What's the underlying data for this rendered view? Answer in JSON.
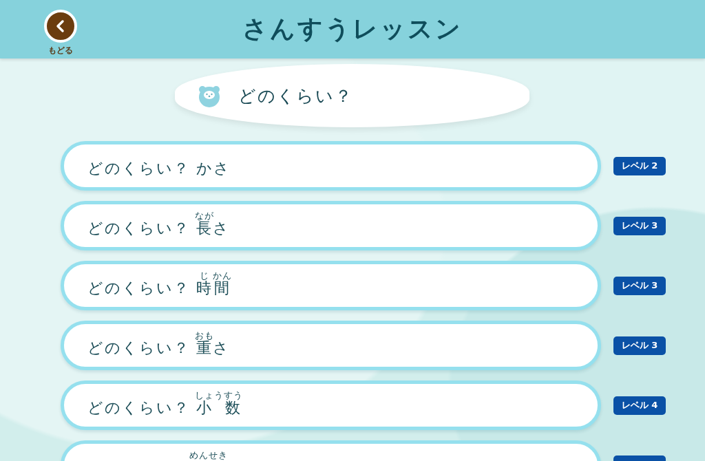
{
  "header": {
    "back_label": "もどる",
    "title": "さんすうレッスン"
  },
  "section": {
    "title": "どのくらい？"
  },
  "lessons": [
    {
      "kind": "full",
      "prefix": "どのくらい？",
      "parts": [
        {
          "base": "かさ"
        }
      ],
      "level": "レベル 2"
    },
    {
      "kind": "full",
      "prefix": "どのくらい？",
      "parts": [
        {
          "base": "長",
          "ruby": "なが"
        },
        {
          "base": "さ"
        }
      ],
      "level": "レベル 3"
    },
    {
      "kind": "full",
      "prefix": "どのくらい？",
      "parts": [
        {
          "base": "時",
          "ruby": "じ"
        },
        {
          "base": "間",
          "ruby": "かん"
        }
      ],
      "level": "レベル 3"
    },
    {
      "kind": "full",
      "prefix": "どのくらい？",
      "parts": [
        {
          "base": "重",
          "ruby": "おも"
        },
        {
          "base": "さ"
        }
      ],
      "level": "レベル 3"
    },
    {
      "kind": "full",
      "prefix": "どのくらい？",
      "parts": [
        {
          "base": "小 数",
          "ruby": "しょうすう"
        }
      ],
      "level": "レベル 4"
    },
    {
      "kind": "cut_off",
      "parts": [
        {
          "ruby": "めんせき"
        }
      ]
    }
  ]
}
